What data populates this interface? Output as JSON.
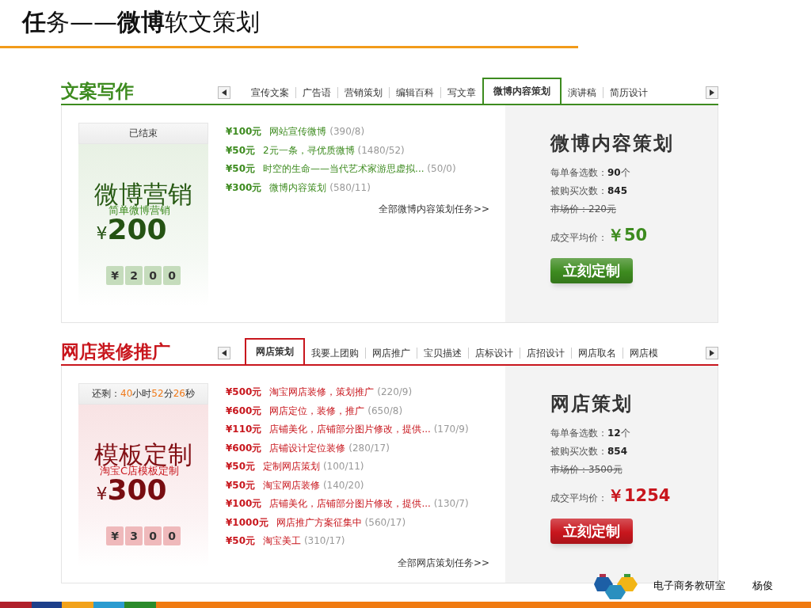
{
  "slide": {
    "title": "**任**务——**微博**软文策划"
  },
  "sections": [
    {
      "heading": "文案写作",
      "color": "#3d8b1f",
      "tabs": [
        {
          "label": "宣传文案",
          "selected": false
        },
        {
          "label": "广告语",
          "selected": false
        },
        {
          "label": "营销策划",
          "selected": false
        },
        {
          "label": "编辑百科",
          "selected": false
        },
        {
          "label": "写文章",
          "selected": false
        },
        {
          "label": "微博内容策划",
          "selected": true
        },
        {
          "label": "演讲稿",
          "selected": false
        },
        {
          "label": "简历设计",
          "selected": false
        }
      ],
      "promo": {
        "status": [
          {
            "text": "已结束",
            "highlight": false
          }
        ],
        "big_title": "微博营销",
        "subtitle": "简单微博营销",
        "currency": "¥",
        "price": "200",
        "price_digits": [
          "¥",
          "2",
          "0",
          "0"
        ]
      },
      "tasks": [
        {
          "price": "¥100元",
          "title": "网站宣传微博",
          "stats": "(390/8)"
        },
        {
          "price": "¥50元",
          "title": "2元一条，寻优质微博",
          "stats": "(1480/52)"
        },
        {
          "price": "¥50元",
          "title": "时空的生命——当代艺术家游思虚拟...",
          "stats": "(50/0)"
        },
        {
          "price": "¥300元",
          "title": "微博内容策划",
          "stats": "(580/11)"
        }
      ],
      "more_link": "全部微博内容策划任务>>",
      "detail": {
        "title": "微博内容策划",
        "stats": [
          {
            "text": "每单备选数：**90**个",
            "struck": false
          },
          {
            "text": "被购买次数：**845**",
            "struck": false
          },
          {
            "text": "市场价：220元",
            "struck": true
          }
        ],
        "avg_label": "成交平均价：",
        "avg_price": "￥50",
        "button": "立刻定制"
      }
    },
    {
      "heading": "网店装修推广",
      "color": "#c8161d",
      "tabs": [
        {
          "label": "网店策划",
          "selected": true
        },
        {
          "label": "我要上团购",
          "selected": false
        },
        {
          "label": "网店推广",
          "selected": false
        },
        {
          "label": "宝贝描述",
          "selected": false
        },
        {
          "label": "店标设计",
          "selected": false
        },
        {
          "label": "店招设计",
          "selected": false
        },
        {
          "label": "网店取名",
          "selected": false
        },
        {
          "label": "网店模",
          "selected": false
        }
      ],
      "promo": {
        "status": [
          {
            "text": "还剩：",
            "highlight": false
          },
          {
            "text": "40",
            "highlight": true
          },
          {
            "text": "小时",
            "highlight": false
          },
          {
            "text": "52",
            "highlight": true
          },
          {
            "text": "分",
            "highlight": false
          },
          {
            "text": "26",
            "highlight": true
          },
          {
            "text": "秒",
            "highlight": false
          }
        ],
        "big_title": "模板定制",
        "subtitle": "淘宝C店模板定制",
        "currency": "¥",
        "price": "300",
        "price_digits": [
          "¥",
          "3",
          "0",
          "0"
        ]
      },
      "tasks": [
        {
          "price": "¥500元",
          "title": "淘宝网店装修，策划推广",
          "stats": "(220/9)"
        },
        {
          "price": "¥600元",
          "title": "网店定位，装修，推广",
          "stats": "(650/8)"
        },
        {
          "price": "¥110元",
          "title": "店铺美化，店铺部分图片修改，提供...",
          "stats": "(170/9)"
        },
        {
          "price": "¥600元",
          "title": "店铺设计定位装修",
          "stats": "(280/17)"
        },
        {
          "price": "¥50元",
          "title": "定制网店策划",
          "stats": "(100/11)"
        },
        {
          "price": "¥50元",
          "title": "淘宝网店装修",
          "stats": "(140/20)"
        },
        {
          "price": "¥100元",
          "title": "店铺美化，店铺部分图片修改，提供...",
          "stats": "(130/7)"
        },
        {
          "price": "¥1000元",
          "title": "网店推广方案征集中",
          "stats": "(560/17)"
        },
        {
          "price": "¥50元",
          "title": "淘宝美工",
          "stats": "(310/17)"
        }
      ],
      "more_link": "全部网店策划任务>>",
      "detail": {
        "title": "网店策划",
        "stats": [
          {
            "text": "每单备选数：**12**个",
            "struck": false
          },
          {
            "text": "被购买次数：**854**",
            "struck": false
          },
          {
            "text": "市场价：3500元",
            "struck": true
          }
        ],
        "avg_label": "成交平均价：",
        "avg_price": "￥1254",
        "button": "立刻定制"
      }
    }
  ],
  "footer": {
    "org": "电子商务教研室",
    "author": "杨俊"
  }
}
